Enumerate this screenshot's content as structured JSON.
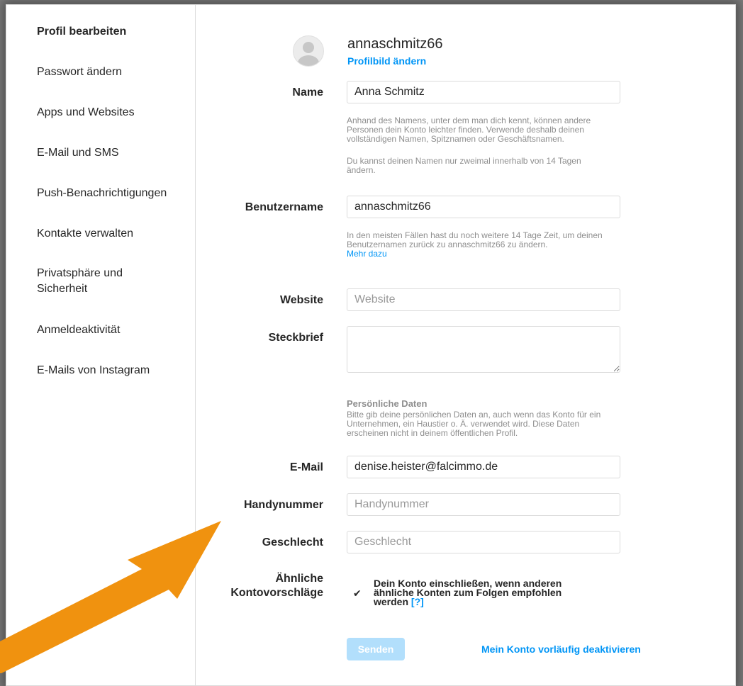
{
  "sidebar": {
    "items": [
      {
        "label": "Profil bearbeiten",
        "active": true
      },
      {
        "label": "Passwort ändern"
      },
      {
        "label": "Apps und Websites"
      },
      {
        "label": "E-Mail und SMS"
      },
      {
        "label": "Push-Benachrichtigungen"
      },
      {
        "label": "Kontakte verwalten"
      },
      {
        "label": "Privatsphäre und Sicherheit"
      },
      {
        "label": "Anmeldeaktivität"
      },
      {
        "label": "E-Mails von Instagram"
      }
    ]
  },
  "profile": {
    "username": "annaschmitz66",
    "change_photo": "Profilbild ändern"
  },
  "form": {
    "name": {
      "label": "Name",
      "value": "Anna Schmitz",
      "help1": "Anhand des Namens, unter dem man dich kennt, können andere Personen dein Konto leichter finden. Verwende deshalb deinen vollständigen Namen, Spitznamen oder Geschäftsnamen.",
      "help2": "Du kannst deinen Namen nur zweimal innerhalb von 14 Tagen ändern."
    },
    "username": {
      "label": "Benutzername",
      "value": "annaschmitz66",
      "help": "In den meisten Fällen hast du noch weitere 14 Tage Zeit, um deinen Benutzernamen zurück zu annaschmitz66 zu ändern.",
      "more": "Mehr dazu"
    },
    "website": {
      "label": "Website",
      "value": "",
      "placeholder": "Website"
    },
    "bio": {
      "label": "Steckbrief",
      "value": ""
    },
    "personal": {
      "title": "Persönliche Daten",
      "help": "Bitte gib deine persönlichen Daten an, auch wenn das Konto für ein Unternehmen, ein Haustier o. Ä. verwendet wird. Diese Daten erscheinen nicht in deinem öffentlichen Profil."
    },
    "email": {
      "label": "E-Mail",
      "value": "denise.heister@falcimmo.de"
    },
    "phone": {
      "label": "Handynummer",
      "value": "",
      "placeholder": "Handynummer"
    },
    "gender": {
      "label": "Geschlecht",
      "value": "",
      "placeholder": "Geschlecht"
    },
    "suggestions": {
      "label": "Ähnliche Kontovorschläge",
      "checkbox_text": "Dein Konto einschließen, wenn anderen ähnliche Konten zum Folgen empfohlen werden",
      "help_link": "[?]",
      "checked": true
    }
  },
  "actions": {
    "send": "Senden",
    "deactivate": "Mein Konto vorläufig deaktivieren"
  },
  "colors": {
    "accent": "#0095f6",
    "send_disabled": "#b2dffc",
    "arrow": "#f0920f"
  }
}
